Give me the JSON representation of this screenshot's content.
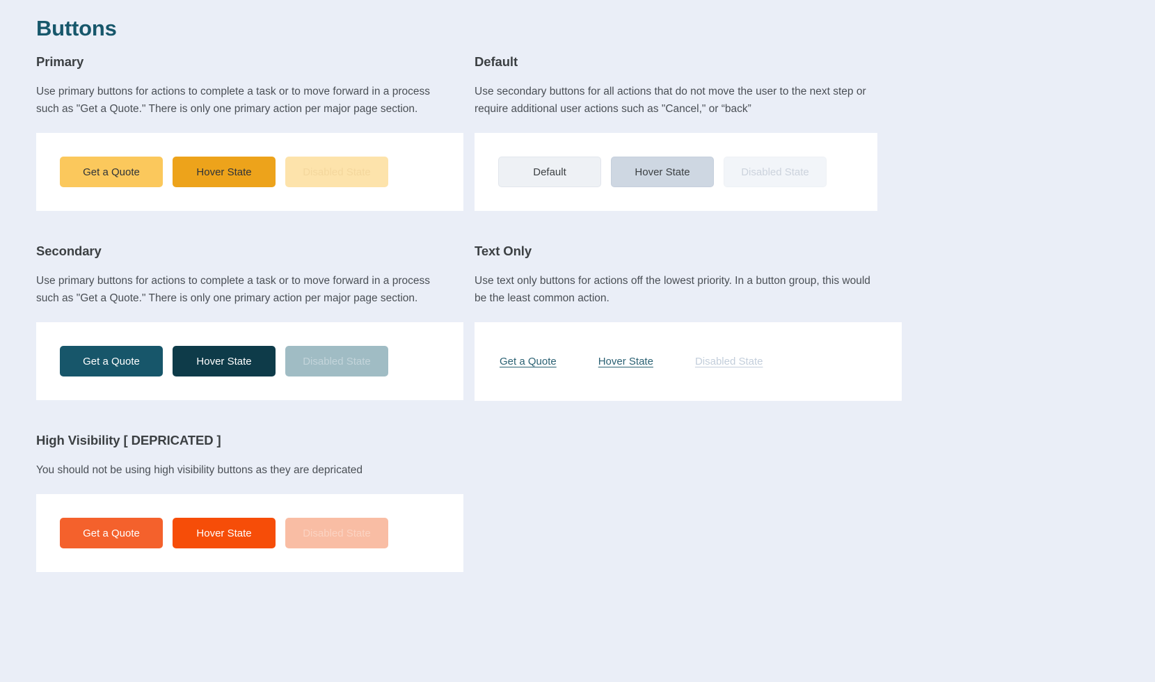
{
  "page": {
    "title": "Buttons"
  },
  "sections": {
    "primary": {
      "title": "Primary",
      "description": "Use primary buttons for actions to complete a task or to move forward in a process such as \"Get a Quote.\" There is only one primary action per major page section.",
      "buttons": {
        "default": "Get a Quote",
        "hover": "Hover State",
        "disabled": "Disabled State"
      },
      "colors": {
        "default": "#FBC85C",
        "hover": "#EDA31B",
        "disabled": "#FDE3AB"
      }
    },
    "default": {
      "title": "Default",
      "description": "Use secondary buttons for all actions that do not move the user to the next step or require additional user actions such as \"Cancel,\" or “back”",
      "buttons": {
        "default": "Default",
        "hover": "Hover State",
        "disabled": "Disabled State"
      },
      "colors": {
        "default": "#EEF1F5",
        "hover": "#CED7E2",
        "disabled": "#F2F5F9"
      }
    },
    "secondary": {
      "title": "Secondary",
      "description": "Use primary buttons for actions to complete a task or to move forward in a process such as \"Get a Quote.\" There is only one primary action per major page section.",
      "buttons": {
        "default": "Get a Quote",
        "hover": "Hover State",
        "disabled": "Disabled State"
      },
      "colors": {
        "default": "#17566A",
        "hover": "#0E3B49",
        "disabled": "#A0BCC4"
      }
    },
    "text_only": {
      "title": "Text Only",
      "description": "Use text only buttons for actions off the lowest priority. In a button group, this would be the least common action.",
      "buttons": {
        "default": "Get a Quote",
        "hover": "Hover State",
        "disabled": "Disabled State"
      },
      "colors": {
        "default": "#2B6173",
        "disabled": "#C3CEDB"
      }
    },
    "high_visibility": {
      "title": "High Visibility [ DEPRICATED ]",
      "description": "You should not be using high visibility buttons as they are depricated",
      "buttons": {
        "default": "Get a Quote",
        "hover": "Hover State",
        "disabled": "Disabled State"
      },
      "colors": {
        "default": "#F4612C",
        "hover": "#F64D08",
        "disabled": "#F9BDA4"
      }
    }
  }
}
